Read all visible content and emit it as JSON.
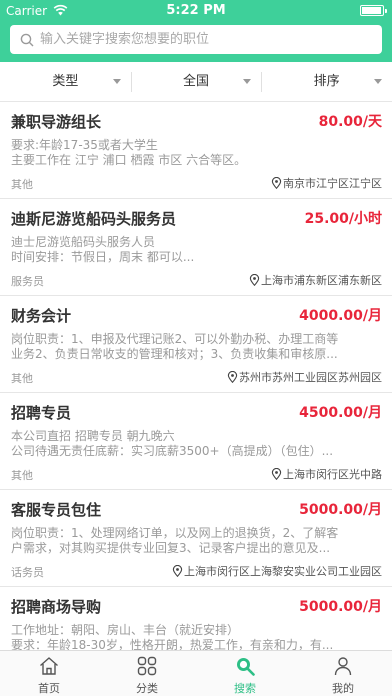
{
  "status_bar": {
    "carrier": "Carrier",
    "time": "5:22 PM"
  },
  "search": {
    "placeholder": "输入关键字搜索您想要的职位"
  },
  "filters": [
    {
      "label": "类型"
    },
    {
      "label": "全国"
    },
    {
      "label": "排序"
    }
  ],
  "jobs": [
    {
      "title": "兼职导游组长",
      "salary": "80.00/天",
      "desc1": "要求:年龄17-35或者大学生",
      "desc2": "主要工作在 江宁 浦口 栖霞 市区 六合等区。",
      "category": "其他",
      "location": "南京市江宁区江宁区"
    },
    {
      "title": "迪斯尼游览船码头服务员",
      "salary": "25.00/小时",
      "desc1": "迪士尼游览船码头服务人员",
      "desc2": "时间安排：节假日，周末 都可以...",
      "category": "服务员",
      "location": "上海市浦东新区浦东新区"
    },
    {
      "title": "财务会计",
      "salary": "4000.00/月",
      "desc1": "岗位职责：1、申报及代理记账2、可以外勤办税、办理工商等",
      "desc2": "业务2、负责日常收支的管理和核对；3、负责收集和审核原...",
      "category": "其他",
      "location": "苏州市苏州工业园区苏州园区"
    },
    {
      "title": "招聘专员",
      "salary": "4500.00/月",
      "desc1": "本公司直招 招聘专员 朝九晚六",
      "desc2": "公司待遇无责任底薪：实习底薪3500+（高提成）（包住）...",
      "category": "其他",
      "location": "上海市闵行区光中路"
    },
    {
      "title": "客服专员包住",
      "salary": "5000.00/月",
      "desc1": "岗位职责：1、处理网络订单，以及网上的退换货，2、了解客",
      "desc2": "户需求，对其购买提供专业回复3、记录客户提出的意见及...",
      "category": "话务员",
      "location": "上海市闵行区上海黎安实业公司工业园区"
    },
    {
      "title": "招聘商场导购",
      "salary": "5000.00/月",
      "desc1": "工作地址：朝阳、房山、丰台（就近安排）",
      "desc2": "要求：年龄18-30岁，性格开朗，热爱工作，有亲和力，有...",
      "category": "",
      "location": ""
    }
  ],
  "tabbar": {
    "home": "首页",
    "category": "分类",
    "search": "搜索",
    "mine": "我的"
  },
  "colors": {
    "brand": "#3ed09a",
    "salary": "#e8253a",
    "active_tab": "#2dbf86"
  }
}
